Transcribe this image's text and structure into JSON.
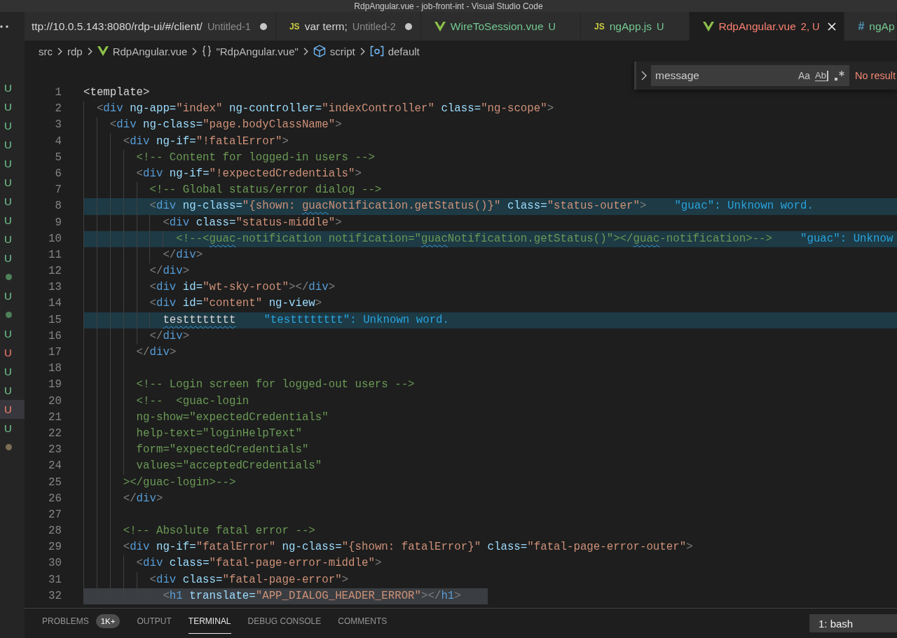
{
  "window": {
    "title": "RdpAngular.vue - job-front-int - Visual Studio Code"
  },
  "sidebar": {
    "items": [
      {
        "kind": "letter",
        "text": "U",
        "color": "#73c991",
        "selected": false
      },
      {
        "kind": "letter",
        "text": "U",
        "color": "#73c991",
        "selected": false
      },
      {
        "kind": "letter",
        "text": "U",
        "color": "#73c991",
        "selected": false
      },
      {
        "kind": "letter",
        "text": "U",
        "color": "#73c991",
        "selected": false
      },
      {
        "kind": "letter",
        "text": "U",
        "color": "#73c991",
        "selected": false
      },
      {
        "kind": "letter",
        "text": "U",
        "color": "#73c991",
        "selected": false
      },
      {
        "kind": "letter",
        "text": "U",
        "color": "#73c991",
        "selected": false
      },
      {
        "kind": "letter",
        "text": "U",
        "color": "#73c991",
        "selected": false
      },
      {
        "kind": "letter",
        "text": "U",
        "color": "#73c991",
        "selected": false
      },
      {
        "kind": "letter",
        "text": "U",
        "color": "#73c991",
        "selected": false
      },
      {
        "kind": "dot",
        "color": "#4f8059",
        "selected": false
      },
      {
        "kind": "letter",
        "text": "U",
        "color": "#73c991",
        "selected": false
      },
      {
        "kind": "dot",
        "color": "#4f8059",
        "selected": false
      },
      {
        "kind": "letter",
        "text": "U",
        "color": "#73c991",
        "selected": false
      },
      {
        "kind": "letter",
        "text": "U",
        "color": "#f88070",
        "selected": false
      },
      {
        "kind": "letter",
        "text": "U",
        "color": "#73c991",
        "selected": false
      },
      {
        "kind": "letter",
        "text": "U",
        "color": "#73c991",
        "selected": false
      },
      {
        "kind": "letter",
        "text": "U",
        "color": "#f88070",
        "selected": true
      },
      {
        "kind": "letter",
        "text": "U",
        "color": "#73c991",
        "selected": false
      },
      {
        "kind": "dot",
        "color": "#7d6d52",
        "selected": false
      }
    ]
  },
  "tabs": [
    {
      "kind": "plain",
      "label": "ttp://10.0.5.143:8080/rdp-ui/#/client/",
      "description": "Untitled-1",
      "dirty": true,
      "selected": false
    },
    {
      "kind": "script",
      "glyph": "JS",
      "label": "var term;",
      "description": "Untitled-2",
      "dirty": true,
      "selected": false
    },
    {
      "kind": "vue",
      "label": "WireToSession.vue",
      "status": "U",
      "color": "#73c991",
      "dirty": false,
      "selected": false
    },
    {
      "kind": "script",
      "glyph": "JS",
      "label": "ngApp.js",
      "status": "U",
      "color": "#73c991",
      "dirty": false,
      "selected": false
    },
    {
      "kind": "vue",
      "label": "RdpAngular.vue",
      "status": "2, U",
      "color": "#f88070",
      "dirty": false,
      "selected": true
    },
    {
      "kind": "style",
      "glyph": "#",
      "label": "ngAp",
      "color": "#73c991",
      "selected": false
    }
  ],
  "breadcrumbs": [
    {
      "kind": "folder",
      "text": "src"
    },
    {
      "kind": "folder",
      "text": "rdp"
    },
    {
      "kind": "vue",
      "text": "RdpAngular.vue"
    },
    {
      "kind": "object",
      "text": "\"RdpAngular.vue\""
    },
    {
      "kind": "module",
      "text": "script"
    },
    {
      "kind": "field",
      "text": "default"
    }
  ],
  "find": {
    "value": "message",
    "options": [
      {
        "kind": "case",
        "label": "Aa",
        "on": false
      },
      {
        "kind": "word",
        "label": "Ab",
        "on": false
      },
      {
        "kind": "regex",
        "on": false
      }
    ],
    "result": "No result"
  },
  "editor": {
    "lines": [
      {
        "number": "1",
        "tokens": [
          {
            "kind": "text",
            "text": "<template>"
          }
        ],
        "selected": false
      },
      {
        "number": "2",
        "tokens": [
          {
            "kind": "bracket",
            "text": "  <"
          },
          {
            "kind": "tag",
            "text": "div"
          },
          {
            "kind": "attr",
            "text": " ng-app="
          },
          {
            "kind": "string",
            "text": "\"index\""
          },
          {
            "kind": "attr",
            "text": " ng-controller="
          },
          {
            "kind": "string",
            "text": "\"indexController\""
          },
          {
            "kind": "attr",
            "text": " class="
          },
          {
            "kind": "string",
            "text": "\"ng-scope\""
          },
          {
            "kind": "bracket",
            "text": ">"
          }
        ],
        "selected": false
      },
      {
        "number": "3",
        "tokens": [
          {
            "kind": "bracket",
            "text": "    <"
          },
          {
            "kind": "tag",
            "text": "div"
          },
          {
            "kind": "attr",
            "text": " ng-class="
          },
          {
            "kind": "string",
            "text": "\"page.bodyClassName\""
          },
          {
            "kind": "bracket",
            "text": ">"
          }
        ],
        "selected": false
      },
      {
        "number": "4",
        "tokens": [
          {
            "kind": "bracket",
            "text": "      <"
          },
          {
            "kind": "tag",
            "text": "div"
          },
          {
            "kind": "attr",
            "text": " ng-if="
          },
          {
            "kind": "string",
            "text": "\"!fatalError\""
          },
          {
            "kind": "bracket",
            "text": ">"
          }
        ],
        "selected": false
      },
      {
        "number": "5",
        "tokens": [
          {
            "kind": "comment",
            "text": "        <!-- Content for logged-in users -->"
          }
        ],
        "selected": false
      },
      {
        "number": "6",
        "tokens": [
          {
            "kind": "bracket",
            "text": "        <"
          },
          {
            "kind": "tag",
            "text": "div"
          },
          {
            "kind": "attr",
            "text": " ng-if="
          },
          {
            "kind": "string",
            "text": "\"!expectedCredentials\""
          },
          {
            "kind": "bracket",
            "text": ">"
          }
        ],
        "selected": false
      },
      {
        "number": "7",
        "tokens": [
          {
            "kind": "comment",
            "text": "          <!-- Global status/error dialog -->"
          }
        ],
        "selected": false
      },
      {
        "number": "8",
        "tokens": [
          {
            "kind": "bracket",
            "text": "          <"
          },
          {
            "kind": "tag",
            "text": "div"
          },
          {
            "kind": "attr",
            "text": " ng-class="
          },
          {
            "kind": "string",
            "text": "\"{shown: "
          },
          {
            "kind": "string",
            "text": "guac",
            "misspelled": true
          },
          {
            "kind": "string",
            "text": "Notification.getStatus()}\""
          },
          {
            "kind": "attr",
            "text": " class="
          },
          {
            "kind": "string",
            "text": "\"status-outer\""
          },
          {
            "kind": "bracket",
            "text": ">"
          }
        ],
        "message": "\"guac\": Unknown word.",
        "selected": false
      },
      {
        "number": "9",
        "tokens": [
          {
            "kind": "bracket",
            "text": "            <"
          },
          {
            "kind": "tag",
            "text": "div"
          },
          {
            "kind": "attr",
            "text": " class="
          },
          {
            "kind": "string",
            "text": "\"status-middle\""
          },
          {
            "kind": "bracket",
            "text": ">"
          }
        ],
        "selected": false
      },
      {
        "number": "10",
        "tokens": [
          {
            "kind": "comment",
            "text": "              <!--<"
          },
          {
            "kind": "comment",
            "text": "guac",
            "misspelled": true
          },
          {
            "kind": "comment",
            "text": "-notification notification=\""
          },
          {
            "kind": "comment",
            "text": "guac",
            "misspelled": true
          },
          {
            "kind": "comment",
            "text": "Notification.getStatus()\"></"
          },
          {
            "kind": "comment",
            "text": "guac",
            "misspelled": true
          },
          {
            "kind": "comment",
            "text": "-notification>-->"
          }
        ],
        "message": "\"guac\": Unknow",
        "selected": false
      },
      {
        "number": "11",
        "tokens": [
          {
            "kind": "bracket",
            "text": "            </"
          },
          {
            "kind": "tag",
            "text": "div"
          },
          {
            "kind": "bracket",
            "text": ">"
          }
        ],
        "selected": false
      },
      {
        "number": "12",
        "tokens": [
          {
            "kind": "bracket",
            "text": "          </"
          },
          {
            "kind": "tag",
            "text": "div"
          },
          {
            "kind": "bracket",
            "text": ">"
          }
        ],
        "selected": false
      },
      {
        "number": "13",
        "tokens": [
          {
            "kind": "bracket",
            "text": "          <"
          },
          {
            "kind": "tag",
            "text": "div"
          },
          {
            "kind": "attr",
            "text": " id="
          },
          {
            "kind": "string",
            "text": "\"wt-sky-root\""
          },
          {
            "kind": "bracket",
            "text": "></"
          },
          {
            "kind": "tag",
            "text": "div"
          },
          {
            "kind": "bracket",
            "text": ">"
          }
        ],
        "selected": false
      },
      {
        "number": "14",
        "tokens": [
          {
            "kind": "bracket",
            "text": "          <"
          },
          {
            "kind": "tag",
            "text": "div"
          },
          {
            "kind": "attr",
            "text": " id="
          },
          {
            "kind": "string",
            "text": "\"content\""
          },
          {
            "kind": "attr",
            "text": " ng-view"
          },
          {
            "kind": "bracket",
            "text": ">"
          }
        ],
        "selected": false
      },
      {
        "number": "15",
        "tokens": [
          {
            "kind": "text",
            "text": "            testttttttt",
            "misspelled": true
          }
        ],
        "message": "\"testttttttt\": Unknown word.",
        "selected": false
      },
      {
        "number": "16",
        "tokens": [
          {
            "kind": "bracket",
            "text": "          </"
          },
          {
            "kind": "tag",
            "text": "div"
          },
          {
            "kind": "bracket",
            "text": ">"
          }
        ],
        "selected": false
      },
      {
        "number": "17",
        "tokens": [
          {
            "kind": "bracket",
            "text": "        </"
          },
          {
            "kind": "tag",
            "text": "div"
          },
          {
            "kind": "bracket",
            "text": ">"
          }
        ],
        "selected": false
      },
      {
        "number": "18",
        "selected": false
      },
      {
        "number": "19",
        "tokens": [
          {
            "kind": "comment",
            "text": "        <!-- Login screen for logged-out users -->"
          }
        ],
        "selected": false
      },
      {
        "number": "20",
        "tokens": [
          {
            "kind": "comment",
            "text": "        <!--  <guac-login"
          }
        ],
        "selected": false
      },
      {
        "number": "21",
        "tokens": [
          {
            "kind": "comment",
            "text": "        ng-show=\"expectedCredentials\""
          }
        ],
        "selected": false
      },
      {
        "number": "22",
        "tokens": [
          {
            "kind": "comment",
            "text": "        help-text=\"loginHelpText\""
          }
        ],
        "selected": false
      },
      {
        "number": "23",
        "tokens": [
          {
            "kind": "comment",
            "text": "        form=\"expectedCredentials\""
          }
        ],
        "selected": false
      },
      {
        "number": "24",
        "tokens": [
          {
            "kind": "comment",
            "text": "        values=\"acceptedCredentials\""
          }
        ],
        "selected": false
      },
      {
        "number": "25",
        "tokens": [
          {
            "kind": "comment",
            "text": "      ></guac-login>-->"
          }
        ],
        "selected": false
      },
      {
        "number": "26",
        "tokens": [
          {
            "kind": "bracket",
            "text": "      </"
          },
          {
            "kind": "tag",
            "text": "div"
          },
          {
            "kind": "bracket",
            "text": ">"
          }
        ],
        "selected": false
      },
      {
        "number": "27",
        "selected": false
      },
      {
        "number": "28",
        "tokens": [
          {
            "kind": "comment",
            "text": "      <!-- Absolute fatal error -->"
          }
        ],
        "selected": false
      },
      {
        "number": "29",
        "tokens": [
          {
            "kind": "bracket",
            "text": "      <"
          },
          {
            "kind": "tag",
            "text": "div"
          },
          {
            "kind": "attr",
            "text": " ng-if="
          },
          {
            "kind": "string",
            "text": "\"fatalError\""
          },
          {
            "kind": "attr",
            "text": " ng-class="
          },
          {
            "kind": "string",
            "text": "\"{shown: fatalError}\""
          },
          {
            "kind": "attr",
            "text": " class="
          },
          {
            "kind": "string",
            "text": "\"fatal-page-error-outer\""
          },
          {
            "kind": "bracket",
            "text": ">"
          }
        ],
        "selected": false
      },
      {
        "number": "30",
        "tokens": [
          {
            "kind": "bracket",
            "text": "        <"
          },
          {
            "kind": "tag",
            "text": "div"
          },
          {
            "kind": "attr",
            "text": " class="
          },
          {
            "kind": "string",
            "text": "\"fatal-page-error-middle\""
          },
          {
            "kind": "bracket",
            "text": ">"
          }
        ],
        "selected": false
      },
      {
        "number": "31",
        "tokens": [
          {
            "kind": "bracket",
            "text": "          <"
          },
          {
            "kind": "tag",
            "text": "div"
          },
          {
            "kind": "attr",
            "text": " class="
          },
          {
            "kind": "string",
            "text": "\"fatal-page-error\""
          },
          {
            "kind": "bracket",
            "text": ">"
          }
        ],
        "selected": false
      },
      {
        "number": "32",
        "tokens": [
          {
            "kind": "bracket",
            "text": "            <"
          },
          {
            "kind": "tag",
            "text": "h1"
          },
          {
            "kind": "attr",
            "text": " translate="
          },
          {
            "kind": "string",
            "text": "\"APP_DIALOG_HEADER_ERROR\""
          },
          {
            "kind": "bracket",
            "text": "></"
          },
          {
            "kind": "tag",
            "text": "h1"
          },
          {
            "kind": "bracket",
            "text": ">"
          }
        ],
        "selected": true
      }
    ]
  },
  "panel": {
    "tabs": [
      {
        "label": "PROBLEMS",
        "badge": "1K+",
        "selected": false
      },
      {
        "label": "OUTPUT",
        "selected": false
      },
      {
        "label": "TERMINAL",
        "selected": true
      },
      {
        "label": "DEBUG CONSOLE",
        "selected": false
      },
      {
        "label": "COMMENTS",
        "selected": false
      }
    ],
    "terminal": "1: bash"
  }
}
